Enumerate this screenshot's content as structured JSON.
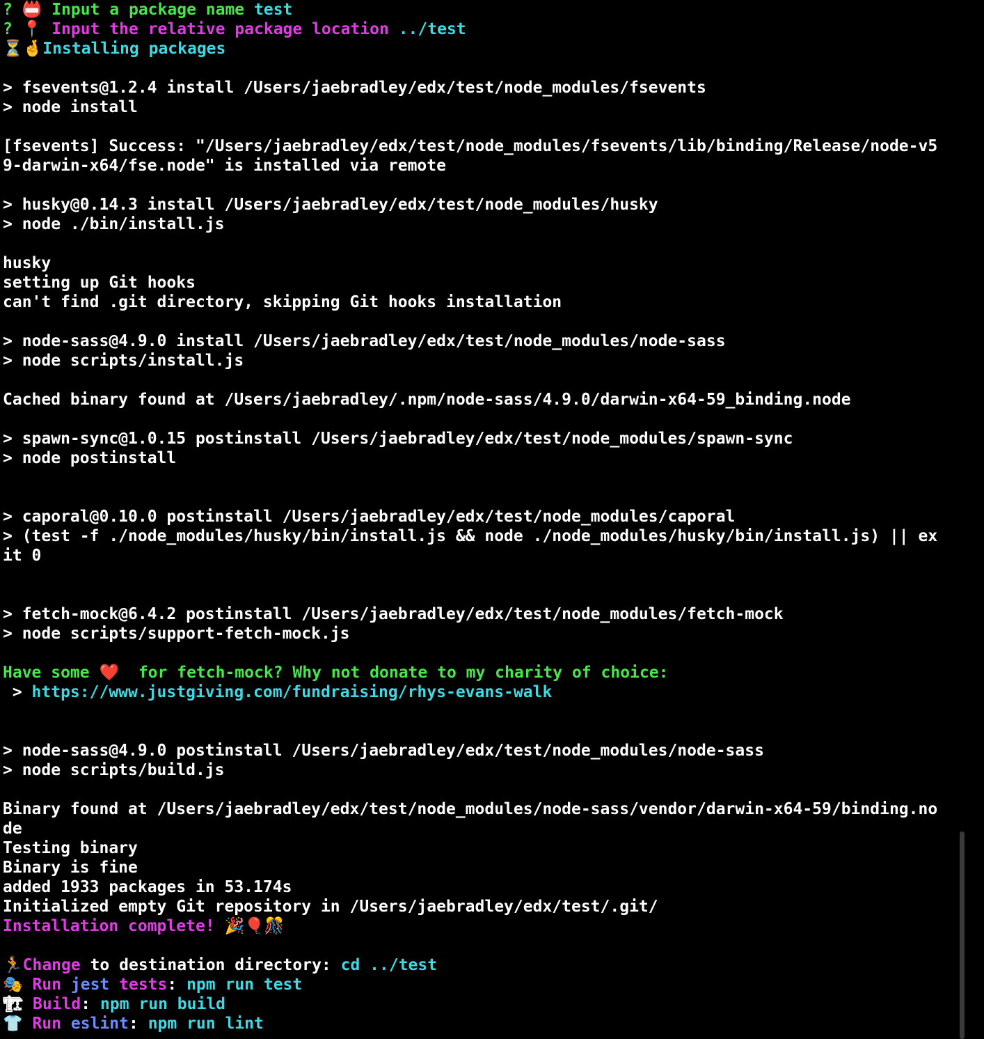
{
  "terminal": {
    "lines": [
      [
        {
          "t": "? ",
          "c": "green"
        },
        {
          "t": "📛 ",
          "c": "white"
        },
        {
          "t": "Input a package name ",
          "c": "green"
        },
        {
          "t": "test",
          "c": "cyan"
        }
      ],
      [
        {
          "t": "? ",
          "c": "green"
        },
        {
          "t": "📍 ",
          "c": "white"
        },
        {
          "t": "Input the relative package location ",
          "c": "magenta"
        },
        {
          "t": "../test",
          "c": "cyan"
        }
      ],
      [
        {
          "t": "⏳",
          "c": "white"
        },
        {
          "t": "🤞",
          "c": "white"
        },
        {
          "t": "Installing packages",
          "c": "cyan"
        }
      ],
      [],
      [
        {
          "t": "> fsevents@1.2.4 install /Users/jaebradley/edx/test/node_modules/fsevents",
          "c": "white"
        }
      ],
      [
        {
          "t": "> node install",
          "c": "white"
        }
      ],
      [],
      [
        {
          "t": "[fsevents] Success: \"/Users/jaebradley/edx/test/node_modules/fsevents/lib/binding/Release/node-v5",
          "c": "white"
        }
      ],
      [
        {
          "t": "9-darwin-x64/fse.node\" is installed via remote",
          "c": "white"
        }
      ],
      [],
      [
        {
          "t": "> husky@0.14.3 install /Users/jaebradley/edx/test/node_modules/husky",
          "c": "white"
        }
      ],
      [
        {
          "t": "> node ./bin/install.js",
          "c": "white"
        }
      ],
      [],
      [
        {
          "t": "husky",
          "c": "white"
        }
      ],
      [
        {
          "t": "setting up Git hooks",
          "c": "white"
        }
      ],
      [
        {
          "t": "can't find .git directory, skipping Git hooks installation",
          "c": "white"
        }
      ],
      [],
      [
        {
          "t": "> node-sass@4.9.0 install /Users/jaebradley/edx/test/node_modules/node-sass",
          "c": "white"
        }
      ],
      [
        {
          "t": "> node scripts/install.js",
          "c": "white"
        }
      ],
      [],
      [
        {
          "t": "Cached binary found at /Users/jaebradley/.npm/node-sass/4.9.0/darwin-x64-59_binding.node",
          "c": "white"
        }
      ],
      [],
      [
        {
          "t": "> spawn-sync@1.0.15 postinstall /Users/jaebradley/edx/test/node_modules/spawn-sync",
          "c": "white"
        }
      ],
      [
        {
          "t": "> node postinstall",
          "c": "white"
        }
      ],
      [],
      [],
      [
        {
          "t": "> caporal@0.10.0 postinstall /Users/jaebradley/edx/test/node_modules/caporal",
          "c": "white"
        }
      ],
      [
        {
          "t": "> (test -f ./node_modules/husky/bin/install.js && node ./node_modules/husky/bin/install.js) || ex",
          "c": "white"
        }
      ],
      [
        {
          "t": "it 0",
          "c": "white"
        }
      ],
      [],
      [],
      [
        {
          "t": "> fetch-mock@6.4.2 postinstall /Users/jaebradley/edx/test/node_modules/fetch-mock",
          "c": "white"
        }
      ],
      [
        {
          "t": "> node scripts/support-fetch-mock.js",
          "c": "white"
        }
      ],
      [],
      [
        {
          "t": "Have some ",
          "c": "green"
        },
        {
          "t": "❤️ ",
          "c": "white"
        },
        {
          "t": " for fetch-mock? Why not donate to my charity of choice:",
          "c": "green"
        }
      ],
      [
        {
          "t": " > ",
          "c": "white"
        },
        {
          "t": "https://www.justgiving.com/fundraising/rhys-evans-walk",
          "c": "cyan"
        }
      ],
      [],
      [],
      [
        {
          "t": "> node-sass@4.9.0 postinstall /Users/jaebradley/edx/test/node_modules/node-sass",
          "c": "white"
        }
      ],
      [
        {
          "t": "> node scripts/build.js",
          "c": "white"
        }
      ],
      [],
      [
        {
          "t": "Binary found at /Users/jaebradley/edx/test/node_modules/node-sass/vendor/darwin-x64-59/binding.no",
          "c": "white"
        }
      ],
      [
        {
          "t": "de",
          "c": "white"
        }
      ],
      [
        {
          "t": "Testing binary",
          "c": "white"
        }
      ],
      [
        {
          "t": "Binary is fine",
          "c": "white"
        }
      ],
      [
        {
          "t": "added 1933 packages in 53.174s",
          "c": "white"
        }
      ],
      [
        {
          "t": "Initialized empty Git repository in /Users/jaebradley/edx/test/.git/",
          "c": "white"
        }
      ],
      [
        {
          "t": "Installation complete! ",
          "c": "magenta"
        },
        {
          "t": "🎉🎈🎊",
          "c": "white"
        }
      ],
      [],
      [
        {
          "t": "🏃",
          "c": "white"
        },
        {
          "t": "Change",
          "c": "magenta"
        },
        {
          "t": " to destination directory: ",
          "c": "white"
        },
        {
          "t": "cd ../test",
          "c": "cyan"
        }
      ],
      [
        {
          "t": "🎭 ",
          "c": "white"
        },
        {
          "t": "Run ",
          "c": "magenta"
        },
        {
          "t": "jest",
          "c": "blue"
        },
        {
          "t": " tests",
          "c": "magenta"
        },
        {
          "t": ": ",
          "c": "white"
        },
        {
          "t": "npm run test",
          "c": "cyan"
        }
      ],
      [
        {
          "t": "🏗 ",
          "c": "white"
        },
        {
          "t": "Build",
          "c": "magenta"
        },
        {
          "t": ": ",
          "c": "white"
        },
        {
          "t": "npm run build",
          "c": "cyan"
        }
      ],
      [
        {
          "t": "👕 ",
          "c": "white"
        },
        {
          "t": "Run ",
          "c": "magenta"
        },
        {
          "t": "eslint",
          "c": "blue"
        },
        {
          "t": ": ",
          "c": "white"
        },
        {
          "t": "npm run lint",
          "c": "cyan"
        }
      ]
    ]
  },
  "colors": {
    "background": "#000000",
    "white": "#ffffff",
    "green": "#47e64a",
    "magenta": "#e13be6",
    "cyan": "#3fd9e3",
    "blue": "#6b8cff"
  }
}
